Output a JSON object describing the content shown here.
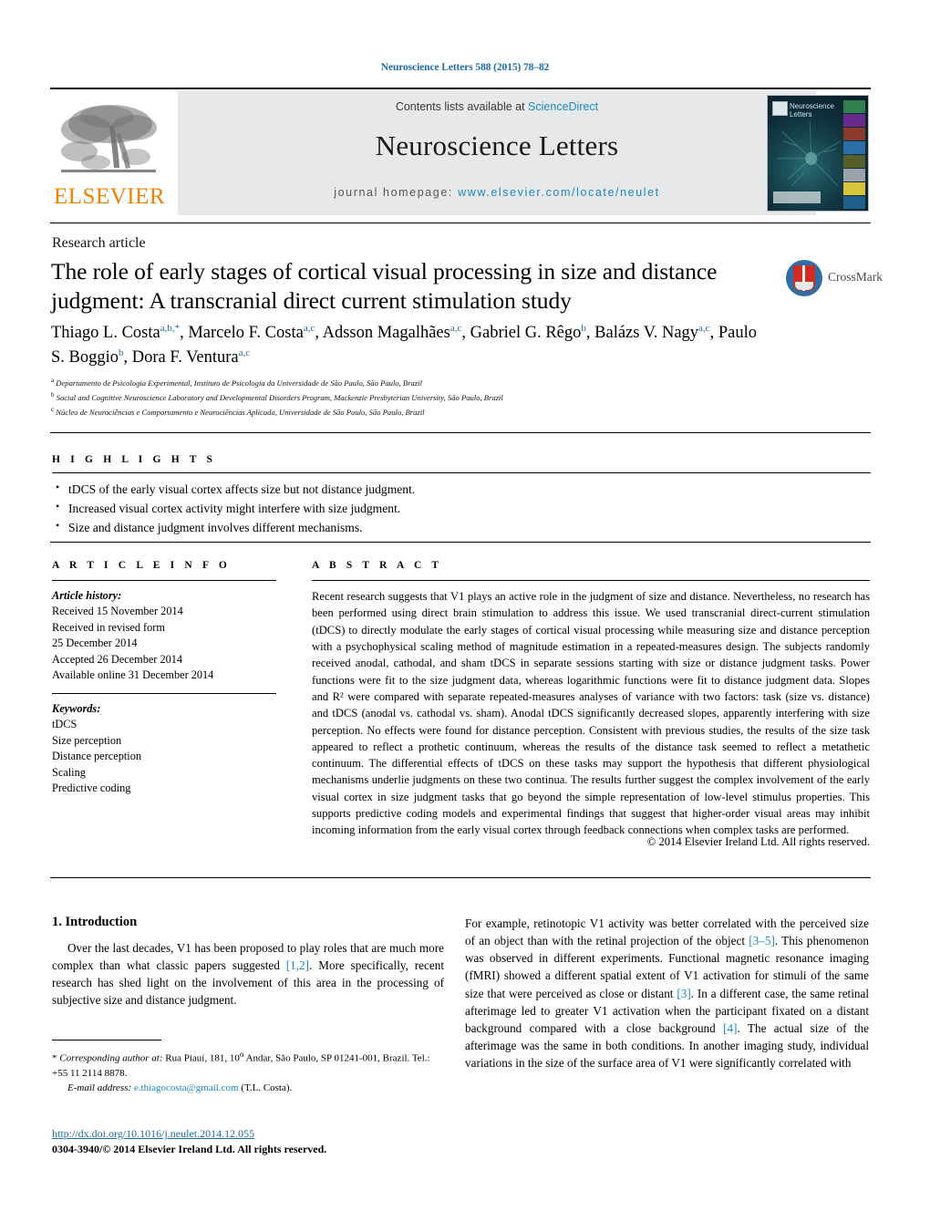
{
  "running_head": "Neuroscience Letters 588 (2015) 78–82",
  "masthead": {
    "contents_prefix": "Contents lists available at ",
    "contents_link": "ScienceDirect",
    "journal_title": "Neuroscience Letters",
    "homepage_prefix": "journal homepage: ",
    "homepage_link": "www.elsevier.com/locate/neulet",
    "publisher_wordmark": "ELSEVIER",
    "publisher_color": "#f08000",
    "link_color": "#1b89c4",
    "band_color": "#e7e8ea",
    "cover_title": "Neuroscience Letters"
  },
  "article": {
    "type": "Research article",
    "title": "The role of early stages of cortical visual processing in size and distance judgment: A transcranial direct current stimulation study",
    "crossmark_label": "CrossMark",
    "authors": [
      {
        "name": "Thiago L. Costa",
        "sup": "a,b,*"
      },
      {
        "name": "Marcelo F. Costa",
        "sup": "a,c"
      },
      {
        "name": "Adsson Magalhães",
        "sup": "a,c"
      },
      {
        "name": "Gabriel G. Rêgo",
        "sup": "b"
      },
      {
        "name": "Balázs V. Nagy",
        "sup": "a,c"
      },
      {
        "name": "Paulo S. Boggio",
        "sup": "b"
      },
      {
        "name": "Dora F. Ventura",
        "sup": "a,c"
      }
    ],
    "affiliations": [
      {
        "marker": "a",
        "text": "Departamento de Psicologia Experimental, Instituto de Psicologia da Universidade de São Paulo, São Paulo, Brazil"
      },
      {
        "marker": "b",
        "text": "Social and Cognitive Neuroscience Laboratory and Developmental Disorders Program, Mackenzie Presbyterian University, São Paulo, Brazil"
      },
      {
        "marker": "c",
        "text": "Núcleo de Neurociências e Comportamento e Neurociências Aplicada, Universidade de São Paulo, São Paulo, Brazil"
      }
    ]
  },
  "highlights": {
    "heading": "H I G H L I G H T S",
    "items": [
      "tDCS of the early visual cortex affects size but not distance judgment.",
      "Increased visual cortex activity might interfere with size judgment.",
      "Size and distance judgment involves different mechanisms."
    ]
  },
  "article_info": {
    "heading": "A R T I C L E   I N F O",
    "history_label": "Article history:",
    "history": [
      "Received 15 November 2014",
      "Received in revised form",
      "25 December 2014",
      "Accepted 26 December 2014",
      "Available online 31 December 2014"
    ],
    "keywords_label": "Keywords:",
    "keywords": [
      "tDCS",
      "Size perception",
      "Distance perception",
      "Scaling",
      "Predictive coding"
    ]
  },
  "abstract": {
    "heading": "A B S T R A C T",
    "text": "Recent research suggests that V1 plays an active role in the judgment of size and distance. Nevertheless, no research has been performed using direct brain stimulation to address this issue. We used transcranial direct-current stimulation (tDCS) to directly modulate the early stages of cortical visual processing while measuring size and distance perception with a psychophysical scaling method of magnitude estimation in a repeated-measures design. The subjects randomly received anodal, cathodal, and sham tDCS in separate sessions starting with size or distance judgment tasks. Power functions were fit to the size judgment data, whereas logarithmic functions were fit to distance judgment data. Slopes and R² were compared with separate repeated-measures analyses of variance with two factors: task (size vs. distance) and tDCS (anodal vs. cathodal vs. sham). Anodal tDCS significantly decreased slopes, apparently interfering with size perception. No effects were found for distance perception. Consistent with previous studies, the results of the size task appeared to reflect a prothetic continuum, whereas the results of the distance task seemed to reflect a metathetic continuum. The differential effects of tDCS on these tasks may support the hypothesis that different physiological mechanisms underlie judgments on these two continua. The results further suggest the complex involvement of the early visual cortex in size judgment tasks that go beyond the simple representation of low-level stimulus properties. This supports predictive coding models and experimental findings that suggest that higher-order visual areas may inhibit incoming information from the early visual cortex through feedback connections when complex tasks are performed.",
    "copyright": "© 2014 Elsevier Ireland Ltd. All rights reserved."
  },
  "body": {
    "section_heading": "1.  Introduction",
    "left_paragraph_pre": "Over the last decades, V1 has been proposed to play roles that are much more complex than what classic papers suggested ",
    "left_ref_1": "[1,2]",
    "left_paragraph_post": ". More specifically, recent research has shed light on the involvement of this area in the processing of subjective size and distance judgment.",
    "right_p1_a": "For example, retinotopic V1 activity was better correlated with the perceived size of an object than with the retinal projection of the object ",
    "right_ref_1": "[3–5]",
    "right_p1_b": ". This phenomenon was observed in different experiments. Functional magnetic resonance imaging (fMRI) showed a different spatial extent of V1 activation for stimuli of the same size that were perceived as close or distant ",
    "right_ref_2": "[3]",
    "right_p1_c": ". In a different case, the same retinal afterimage led to greater V1 activation when the participant fixated on a distant background compared with a close background ",
    "right_ref_3": "[4]",
    "right_p1_d": ". The actual size of the afterimage was the same in both conditions. In another imaging study, individual variations in the size of the surface area of V1 were significantly correlated with"
  },
  "footer": {
    "corresponding_marker": "*",
    "corresponding_label": " Corresponding author at: ",
    "corresponding_address": "Rua Piauí, 181, 10",
    "corresponding_address_sup": "o",
    "corresponding_address_2": " Andar, São Paulo, SP 01241-001, Brazil. Tel.: +55 11 2114 8878.",
    "email_label": "E-mail address:",
    "email": "e.thiagocosta@gmail.com",
    "email_owner": " (T.L. Costa).",
    "doi": "http://dx.doi.org/10.1016/j.neulet.2014.12.055",
    "issn_line": "0304-3940/© 2014 Elsevier Ireland Ltd. All rights reserved."
  }
}
